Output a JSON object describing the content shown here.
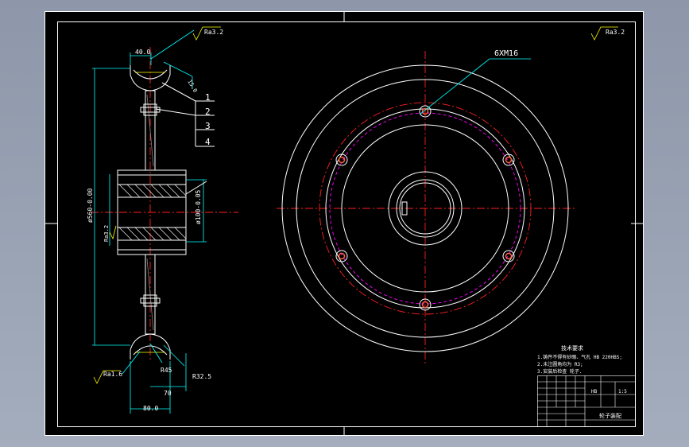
{
  "colors": {
    "background": "#000000",
    "outline": "#ffffff",
    "dimension": "#00ffff",
    "center_line": "#ff2020",
    "bolt_circle": "#ff00ff",
    "annotation": "#ffff00"
  },
  "side_view": {
    "top_roughness": "Ra3.2",
    "top_width": "40.0",
    "chamfer": "15.0",
    "outer_diameter": "ø560-0.00",
    "hub_roughness": "Ra3.2",
    "bore": "ø100-0.05",
    "bottom_roughness": "Ra1.6",
    "radius_45": "R45",
    "radius_32": "R32.5",
    "groove_width": "70",
    "rim_width": "80.0"
  },
  "part_labels": [
    "1",
    "2",
    "3",
    "4"
  ],
  "front_view": {
    "bolt_callout": "6XM16",
    "corner_roughness": "Ra3.2"
  },
  "notes": {
    "heading": "技术要求",
    "lines": [
      "1.铸件不得有砂眼、气孔 HB 220HBS;",
      "2.未注圆角均为 R3;",
      "3.安装后检查 轮子."
    ]
  },
  "title_block": {
    "stamp": "HB",
    "scale": "1:5",
    "drawing_name": "轮子装配"
  }
}
